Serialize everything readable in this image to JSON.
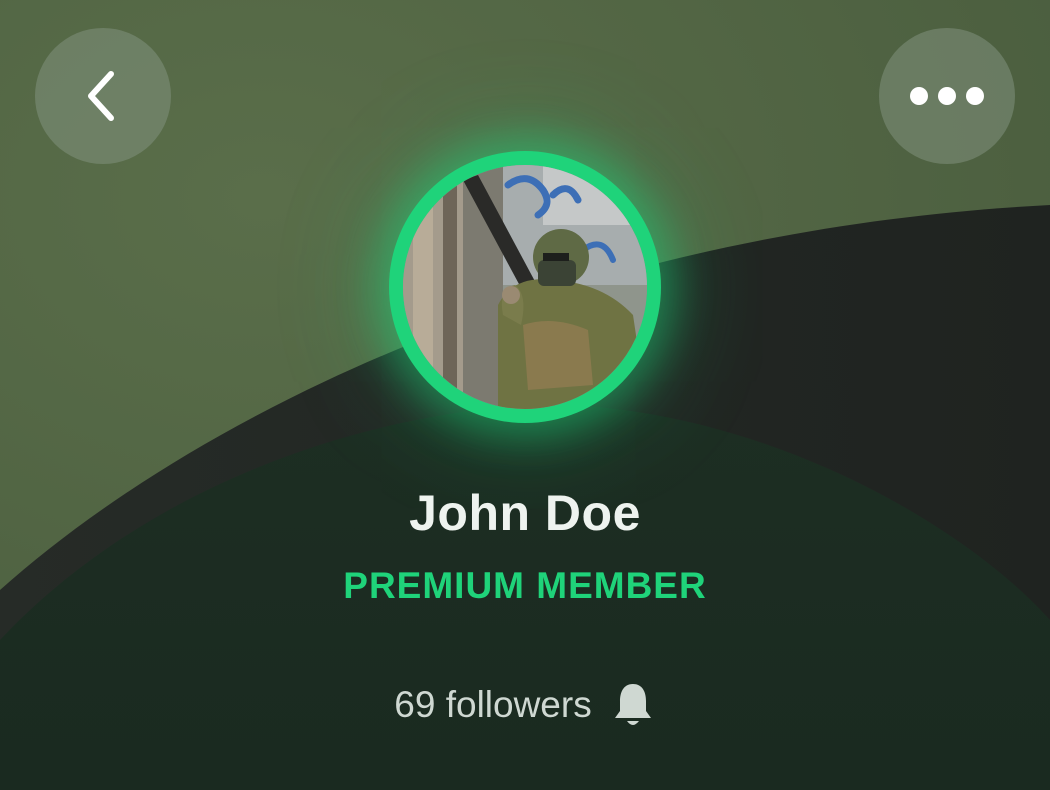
{
  "header": {
    "back_icon": "chevron-left-icon",
    "more_icon": "ellipsis-horizontal-icon"
  },
  "profile": {
    "name": "John Doe",
    "membership": "PREMIUM MEMBER",
    "followers_text": "69 followers",
    "bell_icon": "bell-icon"
  },
  "colors": {
    "accent": "#1fd37a",
    "top_background": "#4f6242",
    "bottom_background": "#1c2a21",
    "name_text": "#eef3ef",
    "secondary_text": "#cfd8d2"
  }
}
